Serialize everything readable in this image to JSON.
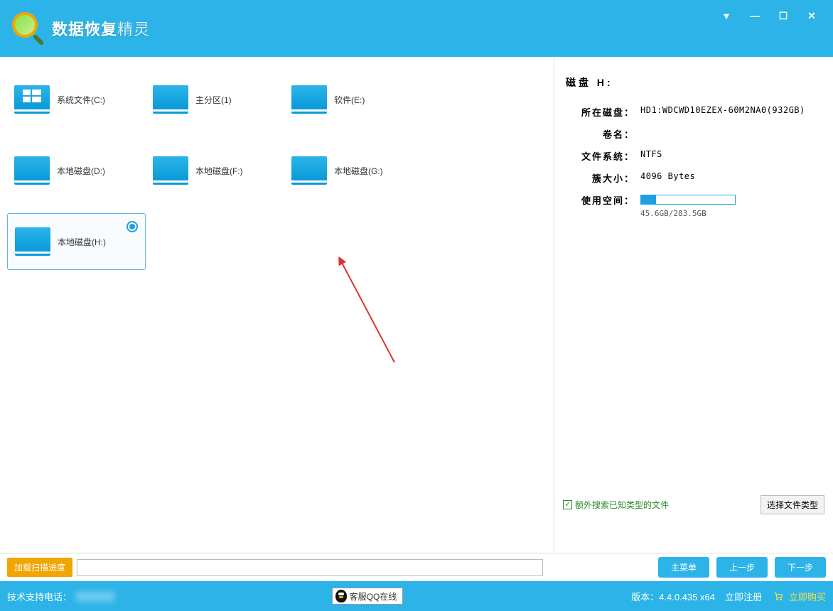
{
  "app": {
    "title_main": "数据恢复",
    "title_suffix": "精灵"
  },
  "window_controls": {
    "dropdown": "▾",
    "minimize": "—",
    "maximize": "☐",
    "close": "✕"
  },
  "drives": [
    {
      "label": "系统文件(C:)",
      "type": "win",
      "selected": false
    },
    {
      "label": "主分区(1)",
      "type": "drive",
      "selected": false
    },
    {
      "label": "软件(E:)",
      "type": "drive",
      "selected": false
    },
    {
      "label": "本地磁盘(D:)",
      "type": "drive",
      "selected": false
    },
    {
      "label": "本地磁盘(F:)",
      "type": "drive",
      "selected": false
    },
    {
      "label": "本地磁盘(G:)",
      "type": "drive",
      "selected": false
    },
    {
      "label": "本地磁盘(H:)",
      "type": "drive",
      "selected": true
    }
  ],
  "info": {
    "title": "磁盘 H:",
    "disk_label": "所在磁盘：",
    "disk_value": "HD1:WDCWD10EZEX-60M2NA0(932GB)",
    "volume_label": "卷名：",
    "volume_value": "",
    "fs_label": "文件系统：",
    "fs_value": "NTFS",
    "cluster_label": "簇大小：",
    "cluster_value": "4096 Bytes",
    "usage_label": "使用空间：",
    "usage_text": "45.6GB/283.5GB",
    "usage_percent": 16
  },
  "options": {
    "extra_search": "额外搜索已知类型的文件",
    "select_types": "选择文件类型"
  },
  "actions": {
    "load_progress": "加载扫描进度",
    "main_menu": "主菜单",
    "prev": "上一步",
    "next": "下一步"
  },
  "status": {
    "support_phone_label": "技术支持电话：",
    "qq_support": "客服QQ在线",
    "version_label": "版本：",
    "version_value": "4.4.0.435 x64",
    "register": "立即注册",
    "buy": "立即购买"
  }
}
